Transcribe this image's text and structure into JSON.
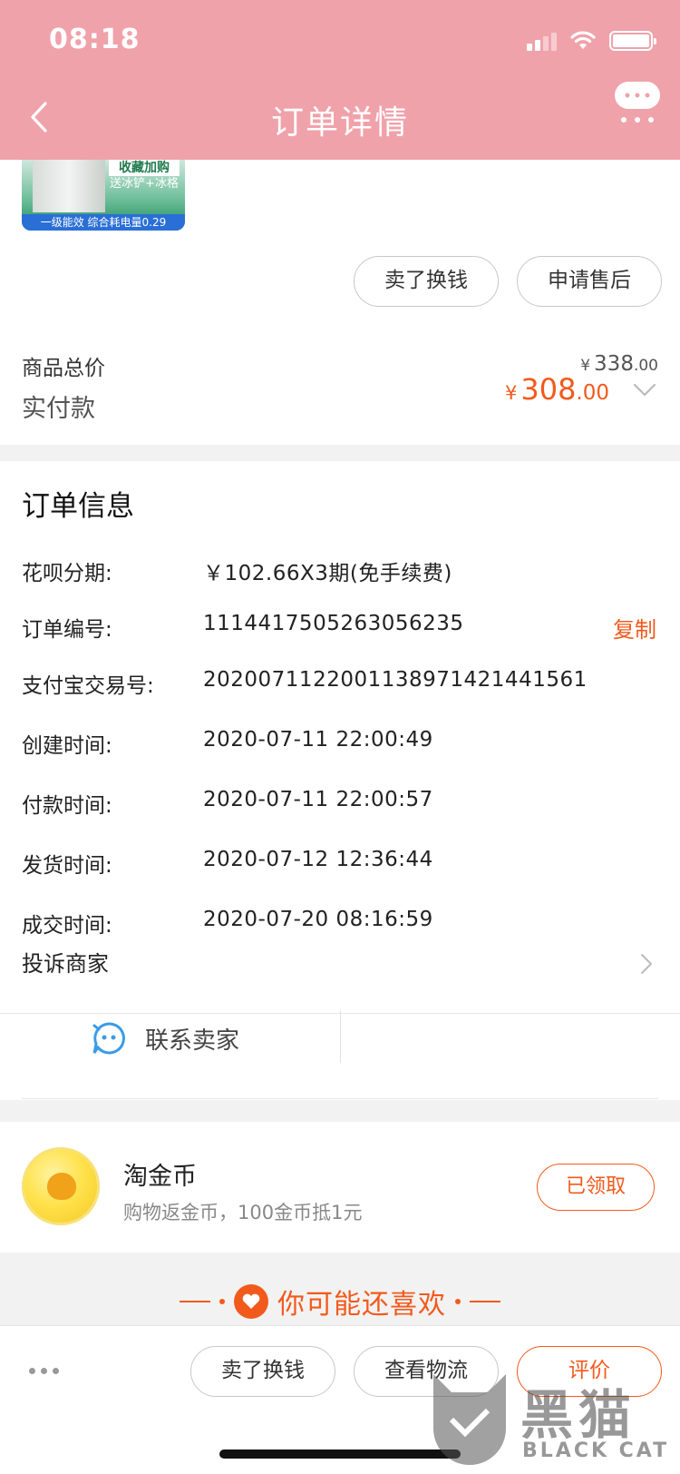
{
  "status_bar": {
    "time": "08:18"
  },
  "header": {
    "title": "订单详情"
  },
  "product": {
    "thumb_promo_line1": "收藏加购",
    "thumb_promo_line2": "送冰铲+冰格",
    "thumb_caption": "一级能效 综合耗电量0.29",
    "actions": [
      "卖了换钱",
      "申请售后"
    ]
  },
  "price": {
    "total_label": "商品总价",
    "total_currency": "¥",
    "total_integer": "338",
    "total_decimal": ".00",
    "paid_label": "实付款",
    "paid_currency": "¥",
    "paid_integer": "308",
    "paid_decimal": ".00"
  },
  "order_info": {
    "title": "订单信息",
    "rows": [
      {
        "key": "花呗分期:",
        "value": "￥102.66X3期(免手续费)"
      },
      {
        "key": "订单编号:",
        "value": "1114417505263056235"
      },
      {
        "key": "支付宝交易号:",
        "value": "2020071122001138971421441561"
      },
      {
        "key": "创建时间:",
        "value": "2020-07-11 22:00:49"
      },
      {
        "key": "付款时间:",
        "value": "2020-07-11 22:00:57"
      },
      {
        "key": "发货时间:",
        "value": "2020-07-12 12:36:44"
      },
      {
        "key": "成交时间:",
        "value": "2020-07-20 08:16:59"
      }
    ],
    "copy_label": "复制",
    "complain_label": "投诉商家",
    "contact_label": "联系卖家"
  },
  "coin": {
    "title": "淘金币",
    "subtitle": "购物返金币，100金币抵1元",
    "button": "已领取"
  },
  "may_like": {
    "title": "你可能还喜欢"
  },
  "bottom_bar": {
    "buttons": [
      "卖了换钱",
      "查看物流",
      "评价"
    ]
  },
  "watermark": {
    "text": "黑猫",
    "sub": "BLACK CAT"
  },
  "colors": {
    "header_bg": "#f0a2ab",
    "accent": "#f25a1c"
  },
  "icons": [
    "back-icon",
    "more-message-icon",
    "chevron-down-icon",
    "chevron-right-icon",
    "chat-bubble-icon",
    "gold-coin-icon",
    "heart-icon",
    "wifi-icon",
    "signal-icon",
    "battery-icon"
  ]
}
